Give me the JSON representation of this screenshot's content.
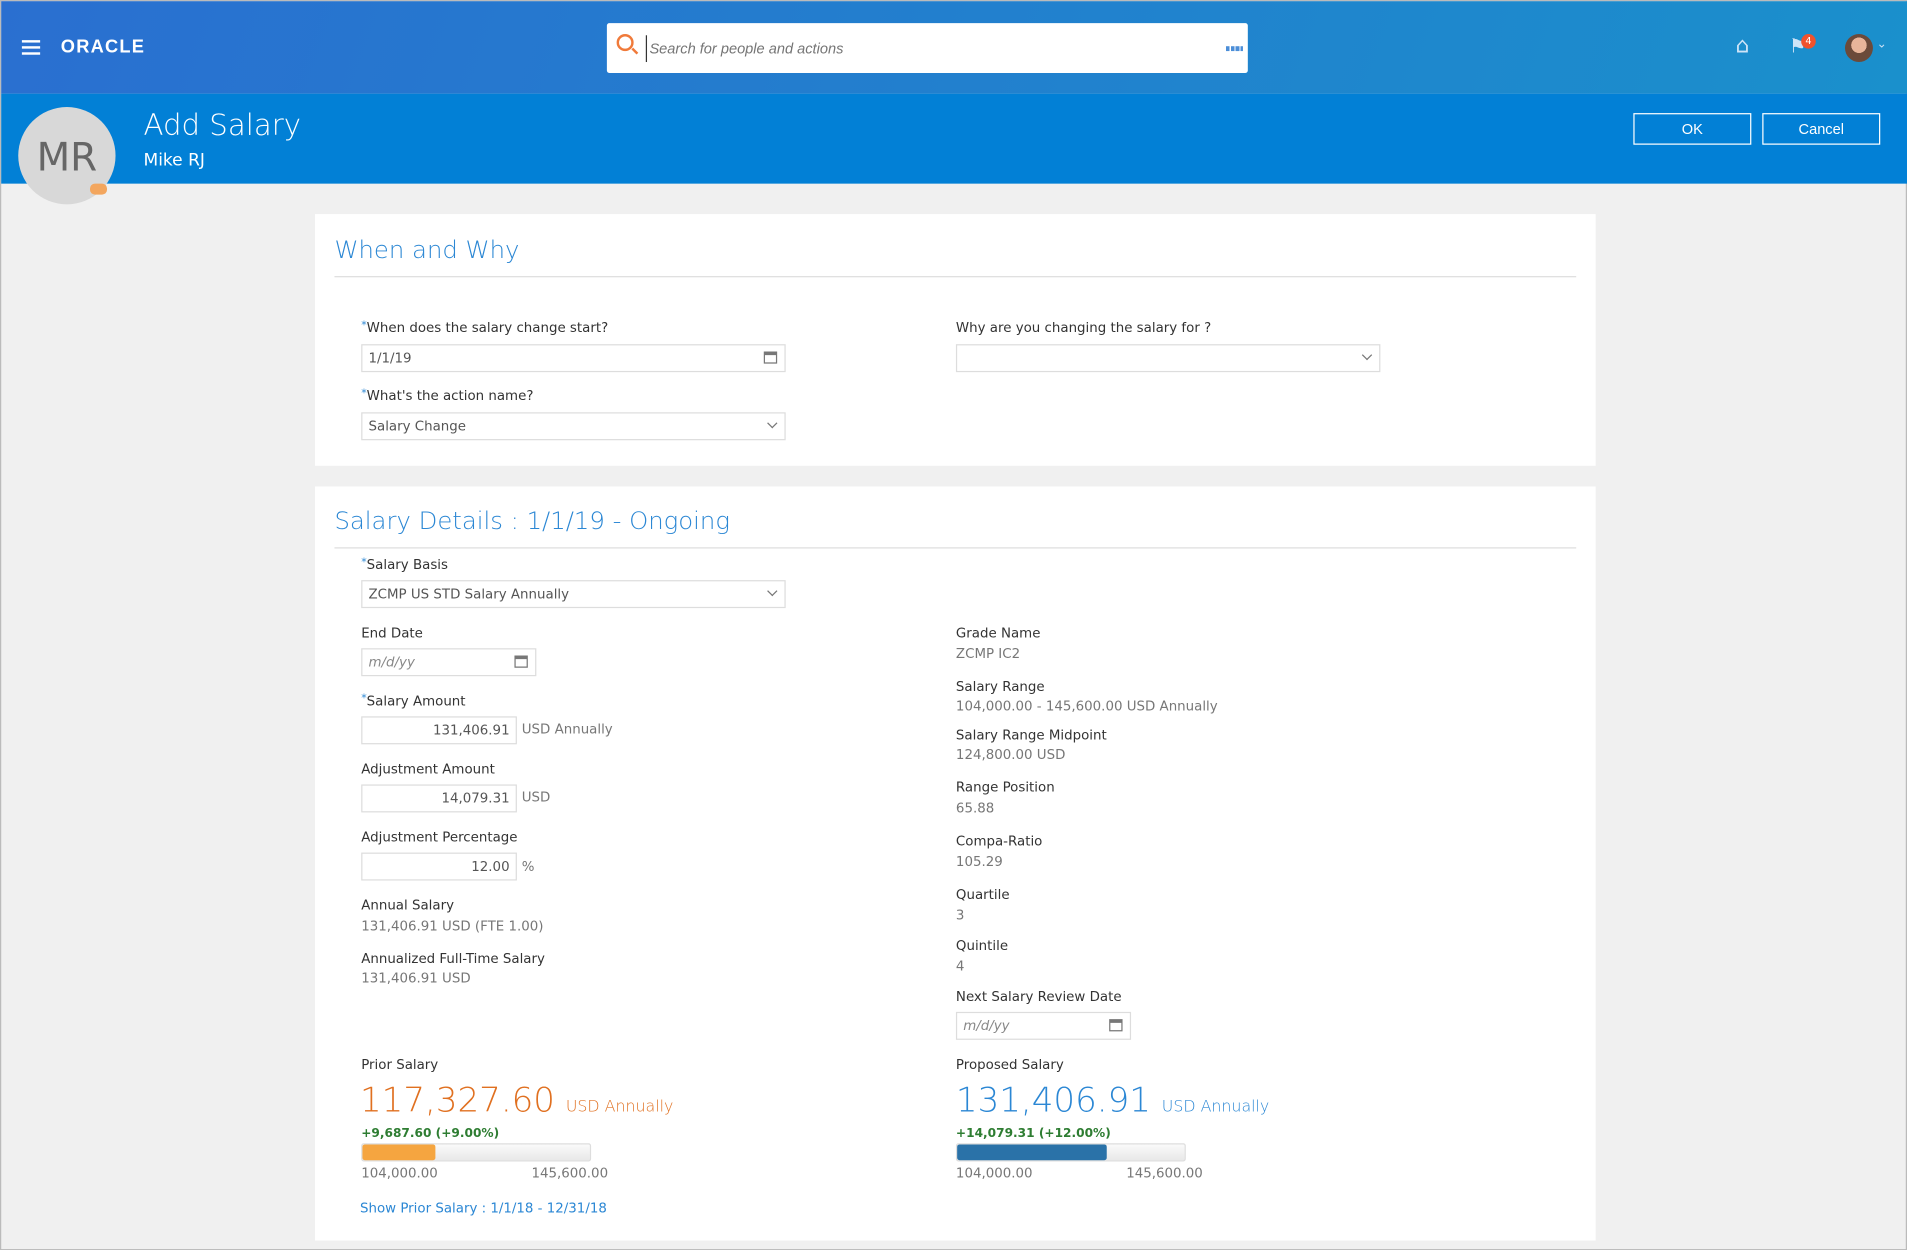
{
  "header": {
    "logo": "ORACLE",
    "search_placeholder": "Search for people and actions",
    "notification_count": "4"
  },
  "banner": {
    "initials": "MR",
    "title": "Add Salary",
    "person": "Mike RJ",
    "ok": "OK",
    "cancel": "Cancel"
  },
  "when_why": {
    "title": "When and Why",
    "start_label": "When does the salary change start?",
    "start_value": "1/1/19",
    "action_label": "What's the action name?",
    "action_value": "Salary Change",
    "reason_label": "Why are you changing the salary for ?",
    "reason_value": ""
  },
  "details": {
    "title": "Salary Details : 1/1/19 - Ongoing",
    "basis_label": "Salary Basis",
    "basis_value": "ZCMP US STD Salary Annually",
    "end_label": "End Date",
    "date_placeholder": "m/d/yy",
    "amount_label": "Salary Amount",
    "amount_value": "131,406.91",
    "amount_unit": "USD Annually",
    "adj_label": "Adjustment Amount",
    "adj_value": "14,079.31",
    "adj_unit": "USD",
    "pct_label": "Adjustment Percentage",
    "pct_value": "12.00",
    "pct_unit": "%",
    "annual_label": "Annual Salary",
    "annual_value": "131,406.91  USD (FTE 1.00)",
    "fulltime_label": "Annualized Full-Time Salary",
    "fulltime_value": "131,406.91  USD",
    "grade_label": "Grade Name",
    "grade_value": "ZCMP IC2",
    "range_label": "Salary Range",
    "range_value": "104,000.00  -  145,600.00  USD    Annually",
    "mid_label": "Salary Range Midpoint",
    "mid_value": "124,800.00  USD",
    "pos_label": "Range Position",
    "pos_value": "65.88",
    "compa_label": "Compa-Ratio",
    "compa_value": "105.29",
    "quartile_label": "Quartile",
    "quartile_value": "3",
    "quintile_label": "Quintile",
    "quintile_value": "4",
    "review_label": "Next Salary Review Date"
  },
  "prior": {
    "label": "Prior Salary",
    "amount": "117,327.60",
    "unit": "USD Annually",
    "delta": "+9,687.60  (+9.00%)",
    "min": "104,000.00",
    "max": "145,600.00",
    "fill_fraction": 0.32,
    "color": "#f5a540",
    "text_color": "#e07020",
    "link": "Show Prior Salary : 1/1/18 - 12/31/18"
  },
  "proposed": {
    "label": "Proposed Salary",
    "amount": "131,406.91",
    "unit": "USD Annually",
    "delta": "+14,079.31  (+12.00%)",
    "min": "104,000.00",
    "max": "145,600.00",
    "fill_fraction": 0.6588,
    "color": "#2a72a8",
    "text_color": "#2b87d4"
  }
}
